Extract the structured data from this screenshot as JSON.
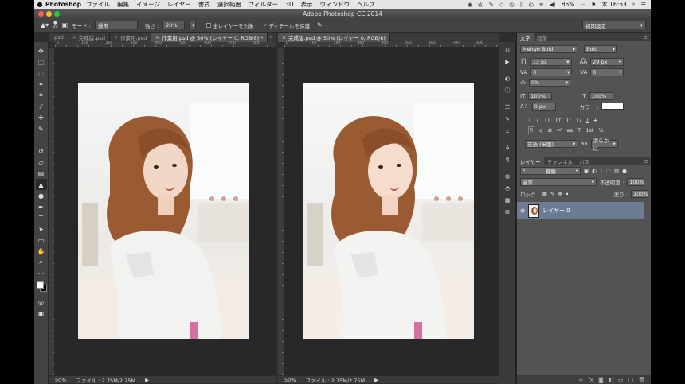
{
  "menubar": {
    "app": "Photoshop",
    "items": [
      "ファイル",
      "編集",
      "イメージ",
      "レイヤー",
      "書式",
      "選択範囲",
      "フィルター",
      "3D",
      "表示",
      "ウィンドウ",
      "ヘルプ"
    ],
    "battery": "85%",
    "clock": "木 16:53"
  },
  "window": {
    "title": "Adobe Photoshop CC 2014"
  },
  "options": {
    "mode_label": "モード :",
    "mode_value": "通常",
    "strength_label": "強さ :",
    "strength_value": "20%",
    "sample_all_label": "全レイヤーを対象",
    "protect_detail_label": "ディテールを保護",
    "brush_size": "20",
    "preset": "初期設定"
  },
  "tabs_left": [
    {
      "label": ".psd",
      "active": false
    },
    {
      "label": "完成版.psd",
      "active": false
    },
    {
      "label": "作業用.psd",
      "active": false
    },
    {
      "label": "作業用.psd @ 50% (レイヤー 0, RGB/8) *",
      "active": true
    }
  ],
  "tabs_right": [
    {
      "label": "完成版.psd @ 50% (レイヤー 0, RGB/8)",
      "active": true
    }
  ],
  "ruler_left": [
    "0",
    "100",
    "200",
    "300",
    "400",
    "500",
    "600",
    "700",
    "800"
  ],
  "ruler_right": [
    "0",
    "100",
    "200",
    "300",
    "400",
    "500",
    "600",
    "700",
    "800"
  ],
  "status_left": {
    "zoom": "50%",
    "file": "ファイル : 2.75M/2.75M"
  },
  "status_right": {
    "zoom": "50%",
    "file": "ファイル : 2.75M/2.75M"
  },
  "character": {
    "tabs": [
      "文字",
      "段落"
    ],
    "font_family": "Meiryo Bold",
    "font_style": "Bold",
    "size": "13 px",
    "leading": "29 px",
    "kerning": "0",
    "tracking": "0",
    "tsume": "0%",
    "vscale": "100%",
    "hscale": "100%",
    "baseline": "0 px",
    "color_label": "カラー :",
    "language": "英語 (米国)",
    "antialias": "滑らかに",
    "aa_label": "aa"
  },
  "layers": {
    "tabs": [
      "レイヤー",
      "チャンネル",
      "パス"
    ],
    "filter_kind": "種類",
    "blend_mode": "通常",
    "opacity_label": "不透明度 :",
    "opacity_value": "100%",
    "lock_label": "ロック :",
    "fill_label": "塗り :",
    "fill_value": "100%",
    "layer_name": "レイヤー 0"
  },
  "colors": {
    "panel_bg": "#535353",
    "selected_layer": "#6c7c94",
    "canvas_bg": "#282828"
  }
}
